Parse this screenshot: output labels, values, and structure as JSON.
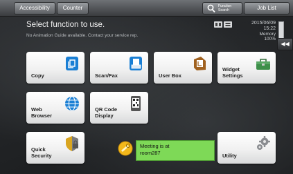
{
  "topbar": {
    "accessibility": "Accessibility",
    "counter": "Counter",
    "search_label": "Function Search",
    "job_list": "Job List"
  },
  "header": {
    "title": "Select function to use.",
    "message": "No Animation Guide available. Contact your service rep.",
    "date": "2015/06/09",
    "time": "15:22",
    "memory_label": "Memory",
    "memory_value": "100%"
  },
  "side_tab": {
    "glyph": "◀◀"
  },
  "tiles": {
    "copy": "Copy",
    "scanfax": "Scan/Fax",
    "userbox": "User Box",
    "widget": "Widget Settings",
    "webbrowser": "Web Browser",
    "qrcode": "QR Code Display",
    "quicksecurity": "Quick Security",
    "utility": "Utility"
  },
  "message": {
    "text": "Meeting is at room287"
  },
  "colors": {
    "accent_blue": "#1a7fd4",
    "message_green": "#7ed957",
    "tile_text": "#222222"
  }
}
